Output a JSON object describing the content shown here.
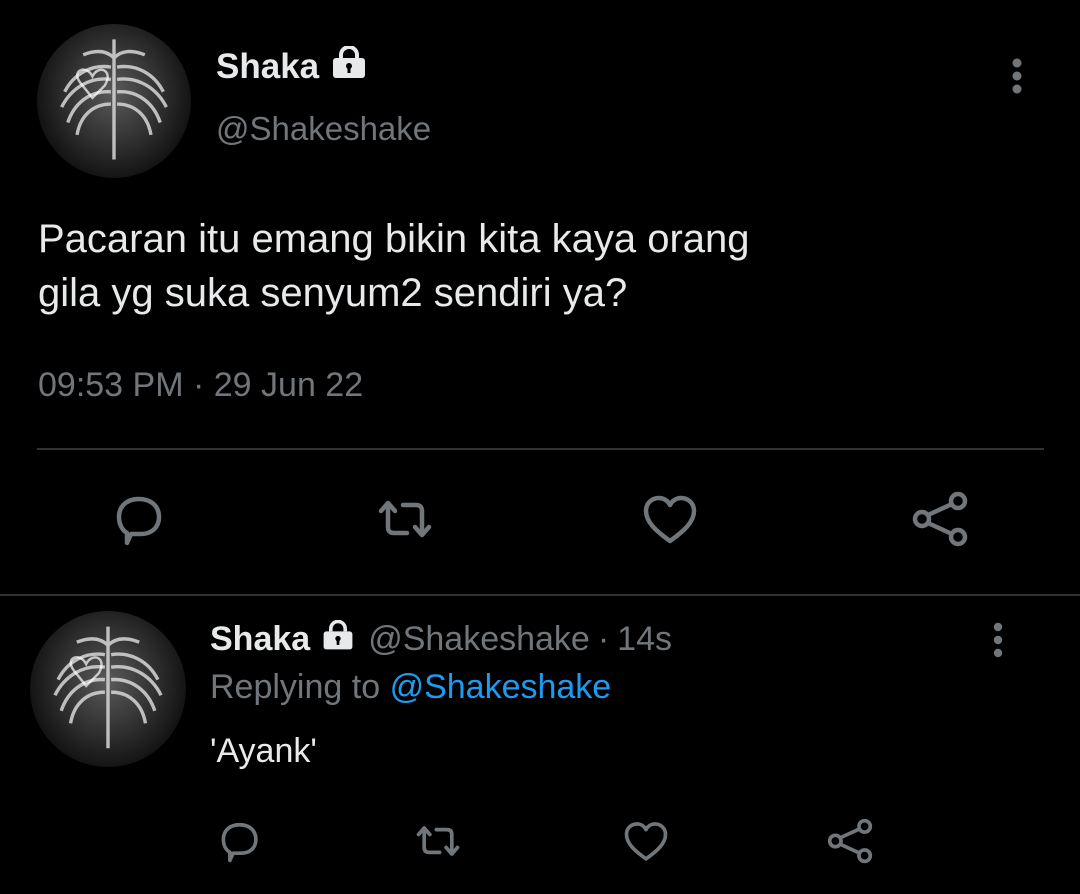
{
  "main_tweet": {
    "display_name": "Shaka",
    "handle": "@Shakeshake",
    "text_line1": "Pacaran itu emang bikin kita kaya orang",
    "text_line2": "gila yg suka senyum2 sendiri ya?",
    "time": "09:53 PM",
    "separator": "·",
    "date": "29 Jun 22",
    "protected_icon": "lock-icon",
    "actions": [
      "reply-icon",
      "retweet-icon",
      "like-icon",
      "share-icon"
    ]
  },
  "reply_tweet": {
    "display_name": "Shaka",
    "handle": "@Shakeshake",
    "separator": "·",
    "age": "14s",
    "replying_to_label": "Replying to",
    "replying_to_handle": "@Shakeshake",
    "text": "'Ayank'",
    "protected_icon": "lock-icon",
    "actions": [
      "reply-icon",
      "retweet-icon",
      "like-icon",
      "share-icon"
    ]
  },
  "colors": {
    "background": "#000000",
    "text_primary": "#e7e9ea",
    "text_muted": "#71767b",
    "link": "#1d9bf0",
    "divider": "#2f3336"
  }
}
